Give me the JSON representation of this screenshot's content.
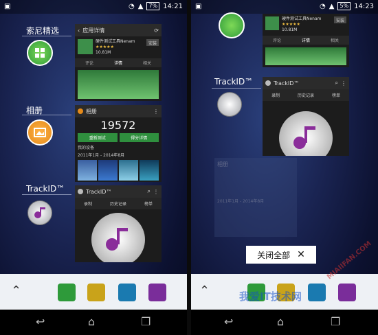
{
  "left": {
    "status": {
      "time": "14:21",
      "battery": "7%"
    },
    "app_labels": {
      "sony_select": "索尼精选",
      "album": "相册",
      "trackid": "TrackID™"
    },
    "card_appdetail": {
      "title": "应用详情",
      "app_name": "硬件测试工具Nenam",
      "rating": "★★★★★",
      "size": "10.81M",
      "install": "安装",
      "tabs": [
        "评论",
        "详情",
        "相关"
      ]
    },
    "card_album": {
      "title": "相册",
      "score": "19572",
      "btn_retest": "重新测试",
      "btn_detail": "得分详情",
      "my_device": "我的设备",
      "date_range": "2011年1月 - 2014年8月"
    },
    "card_trackid": {
      "title": "TrackID™",
      "tabs": [
        "录制",
        "历史记录",
        "榜单"
      ]
    }
  },
  "right": {
    "status": {
      "time": "14:23",
      "battery": "5%"
    },
    "app_labels": {
      "trackid": "TrackID™"
    },
    "card_appdetail": {
      "app_name": "硬件测试工具Nenam",
      "rating": "★★★★★",
      "size": "10.81M",
      "install": "安装",
      "tabs": [
        "评论",
        "详情",
        "相关"
      ]
    },
    "card_trackid": {
      "title": "TrackID™",
      "tabs": [
        "录制",
        "历史记录",
        "榜单"
      ]
    },
    "card_album": {
      "title": "相册",
      "date_range": "2011年1月 - 2014年8月"
    },
    "close_all": "关闭全部"
  },
  "watermark": {
    "text": "我爱IT技术网",
    "url": "MIAIIFAN.COM"
  },
  "colors": {
    "dock_bg": "#eef1f5",
    "sony_green": "#2e9a3a",
    "album_orange": "#e58a1a",
    "trackid_purple": "#8a2d9a"
  }
}
